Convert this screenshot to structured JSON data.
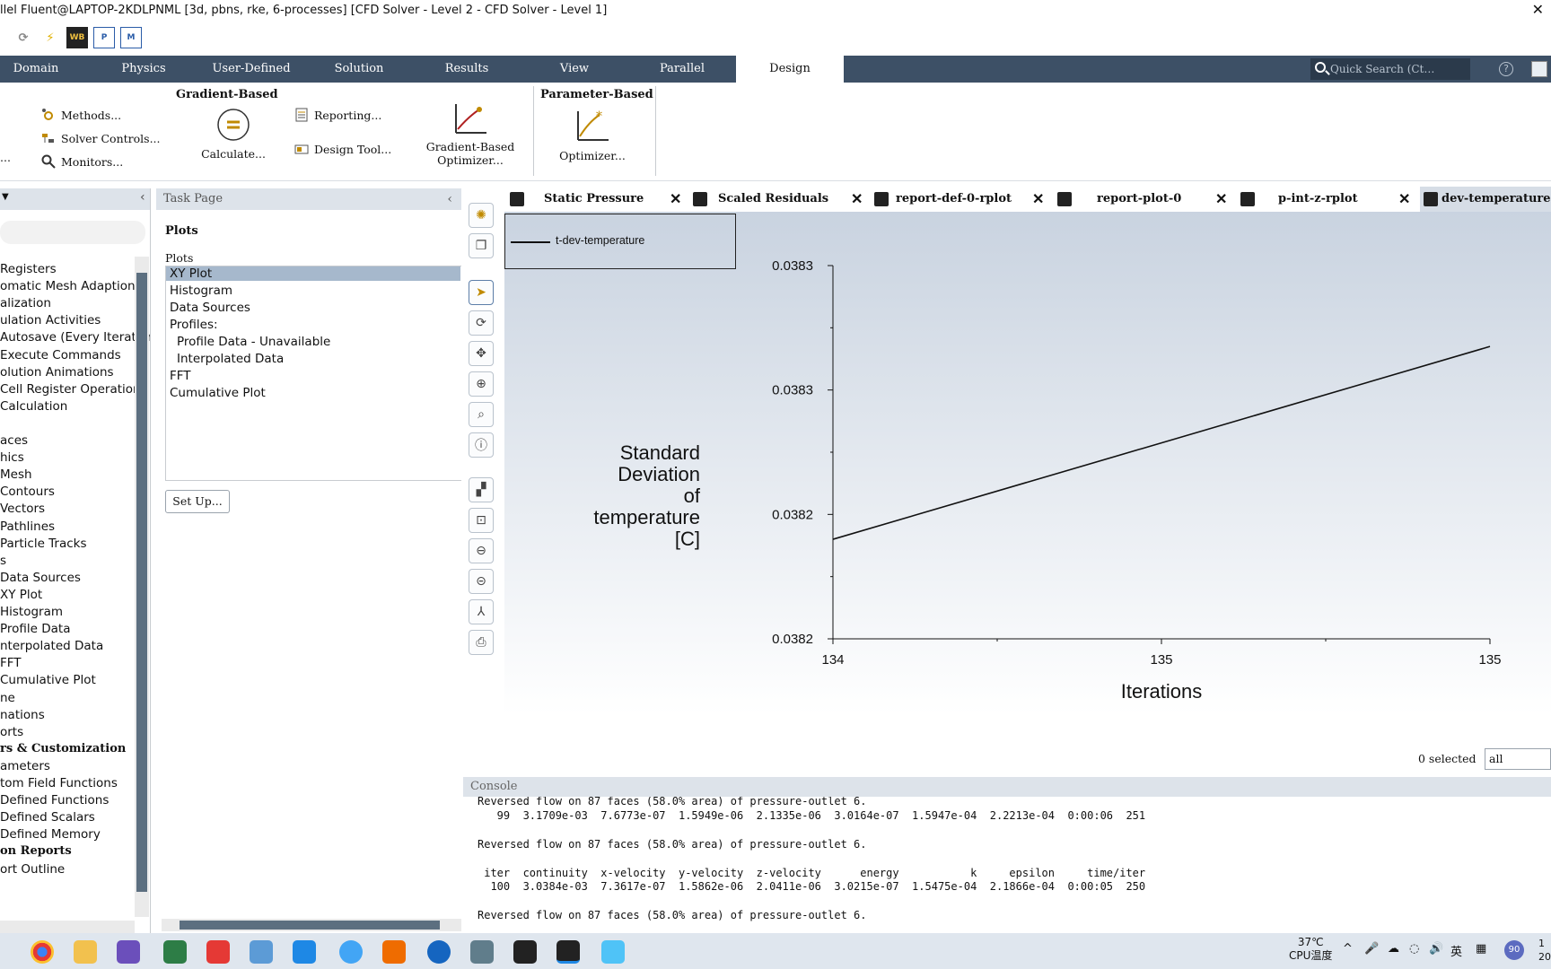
{
  "window": {
    "title": "llel Fluent@LAPTOP-2KDLPNML  [3d, pbns, rke, 6-processes] [CFD Solver - Level 2 - CFD Solver - Level 1]",
    "close": "✕"
  },
  "ribbon_tabs": [
    "Domain",
    "Physics",
    "User-Defined",
    "Solution",
    "Results",
    "View",
    "Parallel",
    "Design"
  ],
  "quick_search": {
    "placeholder": "Quick Search (Ct…"
  },
  "ribbon": {
    "gradient_group_title": "Gradient-Based",
    "parameter_group_title": "Parameter-Based",
    "methods": "Methods...",
    "solver_controls": "Solver Controls...",
    "monitors": "Monitors...",
    "ellipsis": "...",
    "calculate": "Calculate...",
    "reporting": "Reporting...",
    "design_tool": "Design Tool...",
    "gradient_optimizer_l1": "Gradient-Based",
    "gradient_optimizer_l2": "Optimizer...",
    "optimizer": "Optimizer..."
  },
  "tree": {
    "items": [
      "Registers",
      "omatic Mesh Adaption",
      "alization",
      "ulation Activities",
      "Autosave (Every Iteration",
      "Execute Commands",
      "olution Animations",
      "Cell Register Operations",
      " Calculation",
      "",
      "aces",
      "hics",
      "Mesh",
      "Contours",
      "Vectors",
      "Pathlines",
      "Particle Tracks",
      "s",
      "Data Sources",
      "XY Plot",
      "Histogram",
      "Profile Data",
      "nterpolated Data",
      "FFT",
      "Cumulative Plot",
      "ne",
      "nations",
      "orts"
    ],
    "section_params": "rs & Customization",
    "items2": [
      "ameters",
      "tom Field Functions",
      " Defined Functions",
      " Defined Scalars",
      " Defined Memory"
    ],
    "section_reports": "on Reports",
    "last": "ort Outline"
  },
  "task_page": {
    "header": "Task Page",
    "title": "Plots",
    "list_label": "Plots",
    "items": [
      "XY Plot",
      "Histogram",
      "Data Sources",
      "Profiles:",
      "Profile Data - Unavailable",
      "Interpolated Data",
      "FFT",
      "Cumulative Plot"
    ],
    "setup_button": "Set Up..."
  },
  "plot_tabs": [
    "Static Pressure",
    "Scaled Residuals",
    "report-def-0-rplot",
    "report-plot-0",
    "p-int-z-rplot",
    "dev-temperature-"
  ],
  "legend": {
    "series": "t-dev-temperature"
  },
  "chart_data": {
    "type": "line",
    "ylabel_lines": [
      "Standard",
      "Deviation",
      "of",
      "temperature",
      "[C]"
    ],
    "xlabel": "Iterations",
    "x_tick_labels": [
      "134",
      "135",
      "135"
    ],
    "y_tick_labels": [
      "0.0383",
      "0.0383",
      "0.0382",
      "0.0382"
    ],
    "series": [
      {
        "name": "t-dev-temperature",
        "x": [
          134,
          135
        ],
        "y": [
          0.03818,
          0.038335
        ]
      }
    ],
    "xlim": [
      134,
      135
    ],
    "ylim": [
      0.0381,
      0.0384
    ],
    "grid": false,
    "legend_position": "top-left"
  },
  "selection": {
    "count_label": "0 selected",
    "filter_value": "all"
  },
  "console": {
    "header": "Console",
    "lines": [
      "Reversed flow on 87 faces (58.0% area) of pressure-outlet 6.",
      "   99  3.1709e-03  7.6773e-07  1.5949e-06  2.1335e-06  3.0164e-07  1.5947e-04  2.2213e-04  0:00:06  251",
      "",
      "Reversed flow on 87 faces (58.0% area) of pressure-outlet 6.",
      "",
      " iter  continuity  x-velocity  y-velocity  z-velocity      energy           k     epsilon     time/iter",
      "  100  3.0384e-03  7.3617e-07  1.5862e-06  2.0411e-06  3.0215e-07  1.5475e-04  2.1866e-04  0:00:05  250",
      "",
      "Reversed flow on 87 faces (58.0% area) of pressure-outlet 6."
    ]
  },
  "taskbar": {
    "temp_value": "37℃",
    "temp_label": "CPU温度",
    "ime": "英",
    "badge": "90",
    "clock_1": "1",
    "clock_2": "20"
  }
}
